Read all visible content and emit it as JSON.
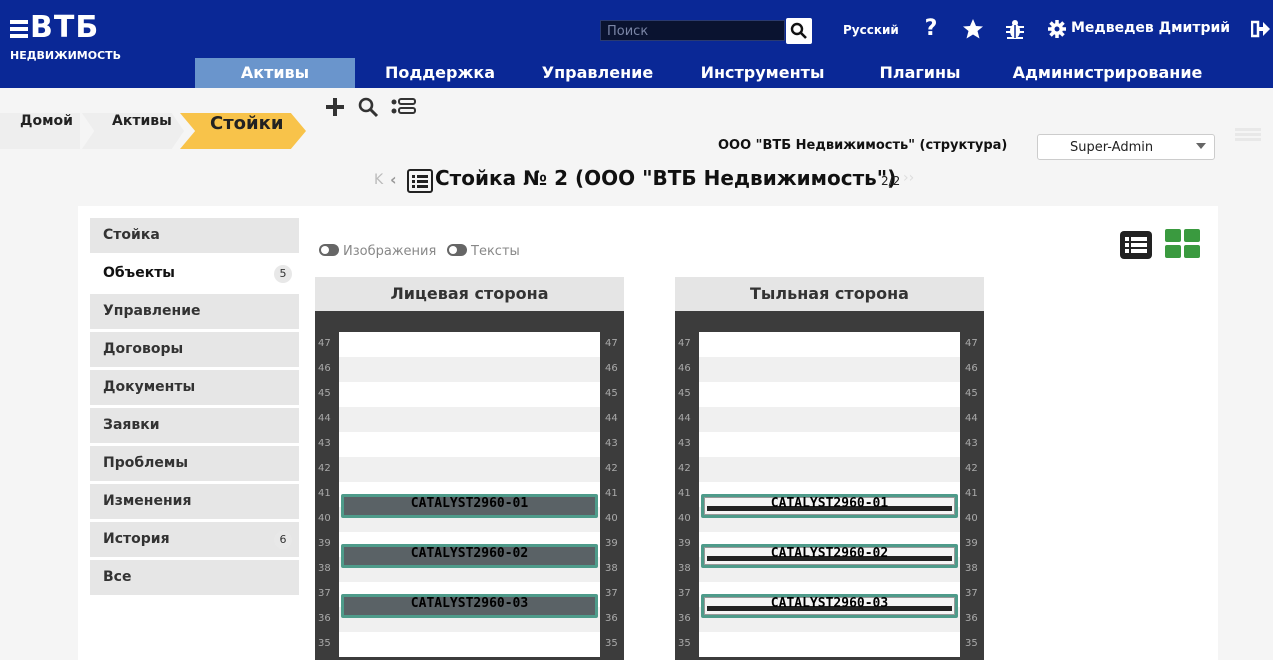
{
  "header": {
    "logo": "ВТБ",
    "logo_sub": "НЕДВИЖИМОСТЬ",
    "search_placeholder": "Поиск",
    "language": "Русский",
    "user": "Медведев Дмитрий",
    "icons": [
      "search-icon",
      "help-icon",
      "star-icon",
      "bug-icon",
      "gear-icon",
      "logout-icon"
    ]
  },
  "nav": {
    "items": [
      "Активы",
      "Поддержка",
      "Управление",
      "Инструменты",
      "Плагины",
      "Администрирование"
    ],
    "active": "Активы"
  },
  "toolbar": {
    "icons": [
      "add-icon",
      "search-icon",
      "list-toggle-icon"
    ]
  },
  "breadcrumb": [
    "Домой",
    "Активы",
    "Стойки"
  ],
  "org": "ООО \"ВТБ Недвижимость\" (структура)",
  "role": "Super-Admin",
  "title": "Стойка № 2 (ООО \"ВТБ Недвижимость\")",
  "page_count": "2/2",
  "sidebar": {
    "items": [
      {
        "label": "Стойка",
        "count": ""
      },
      {
        "label": "Объекты",
        "count": "5"
      },
      {
        "label": "Управление",
        "count": ""
      },
      {
        "label": "Договоры",
        "count": ""
      },
      {
        "label": "Документы",
        "count": ""
      },
      {
        "label": "Заявки",
        "count": ""
      },
      {
        "label": "Проблемы",
        "count": ""
      },
      {
        "label": "Изменения",
        "count": ""
      },
      {
        "label": "История",
        "count": "6"
      },
      {
        "label": "Все",
        "count": ""
      }
    ],
    "active": "Объекты"
  },
  "toggles": [
    "Изображения",
    "Тексты"
  ],
  "racks": {
    "front_title": "Лицевая сторона",
    "rear_title": "Тыльная сторона",
    "units": [
      "47",
      "46",
      "45",
      "44",
      "43",
      "42",
      "41",
      "40",
      "39",
      "38",
      "37",
      "36",
      "35"
    ],
    "devices": [
      "CATALYST2960-01",
      "CATALYST2960-02",
      "CATALYST2960-03"
    ]
  },
  "colors": {
    "header": "#0a2896",
    "nav_active": "#6a95cc",
    "crumb_active": "#f8c34a",
    "view_icon": "#3a9a3f"
  }
}
